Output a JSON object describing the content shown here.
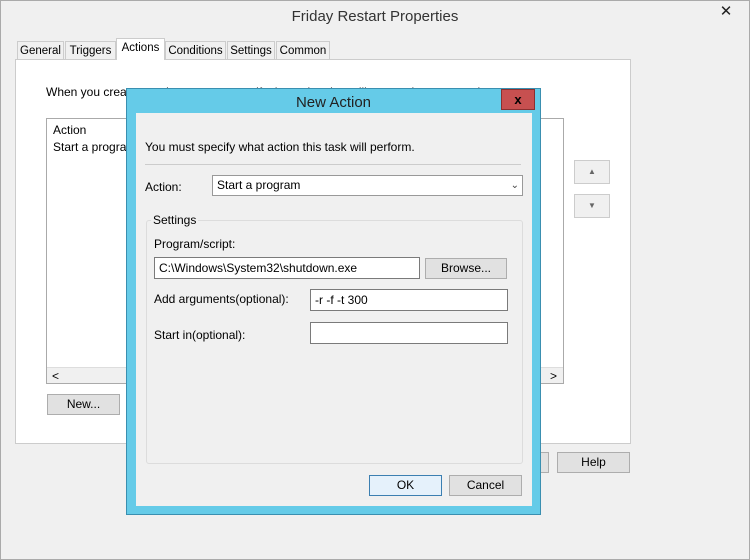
{
  "window": {
    "title": "Friday Restart Properties",
    "close": "✕"
  },
  "tabs": [
    {
      "label": "General"
    },
    {
      "label": "Triggers"
    },
    {
      "label": "Actions",
      "active": true
    },
    {
      "label": "Conditions"
    },
    {
      "label": "Settings"
    },
    {
      "label": "Common"
    }
  ],
  "actions_tab": {
    "intro": "When you create a task, you must specify the action that will occur when your task starts.",
    "list_header": "Action",
    "rows": [
      "Start a program"
    ],
    "new_button": "New...",
    "scroll_left": "<",
    "scroll_right": ">",
    "move_up": "▲",
    "move_down": "▼"
  },
  "footer": {
    "help_button": "Help"
  },
  "dialog": {
    "title": "New Action",
    "close": "x",
    "instruction": "You must specify what action this task will perform.",
    "action_label": "Action:",
    "action_value": "Start a program",
    "settings_label": "Settings",
    "program_label": "Program/script:",
    "program_value": "C:\\Windows\\System32\\shutdown.exe",
    "browse_button": "Browse...",
    "args_label": "Add arguments(optional):",
    "args_value": "-r -f -t 300",
    "startin_label": "Start in(optional):",
    "startin_value": "",
    "ok_button": "OK",
    "cancel_button": "Cancel"
  },
  "colors": {
    "dialog_frame": "#65cbe8",
    "close_button": "#c75050"
  }
}
